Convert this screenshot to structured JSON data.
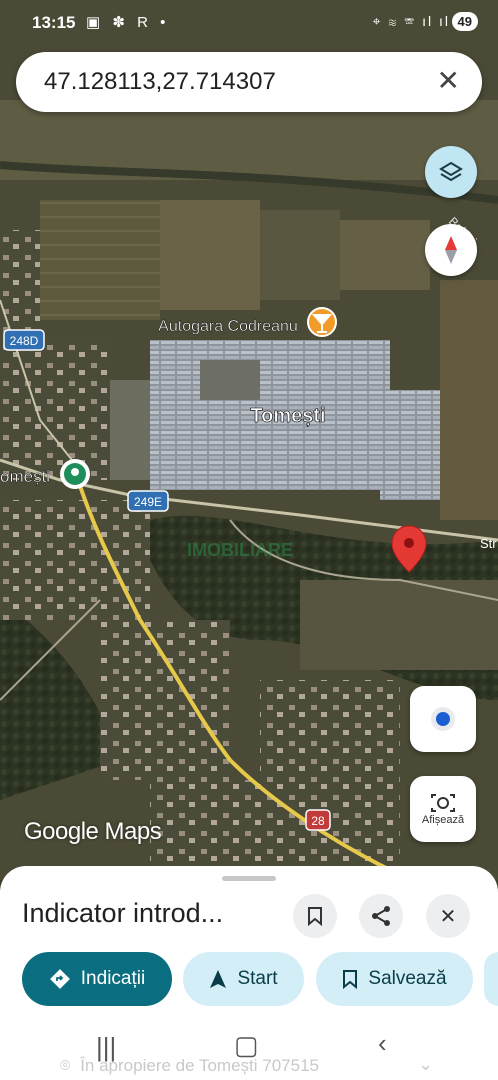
{
  "status_bar": {
    "time": "13:15",
    "left_icons": "▣ ✽ R •",
    "right_icons": "⌖ ≋ ☏ ıl ıl",
    "battery": "49"
  },
  "search": {
    "query": "47.128113,27.714307"
  },
  "map_labels": {
    "place": "Tomești",
    "bus_station": "Autogara Codreanu",
    "left_place": "omești",
    "road_248d": "248D",
    "road_249e": "249E",
    "road_28": "28",
    "street_fragment": "Str",
    "edge_fragment": "Bahlui",
    "watermark": "IMOBILIARE"
  },
  "controls": {
    "lens_label": "Afișează"
  },
  "google_logo": "Google Maps",
  "sheet": {
    "title": "Indicator introd...",
    "btn_directions": "Indicații",
    "btn_start": "Start",
    "btn_save": "Salvează"
  },
  "peek": {
    "nearby": "În apropiere de Tomești 707515"
  },
  "colors": {
    "pin": "#e53935",
    "accent": "#0b6e80",
    "chip": "#d3eef7"
  }
}
